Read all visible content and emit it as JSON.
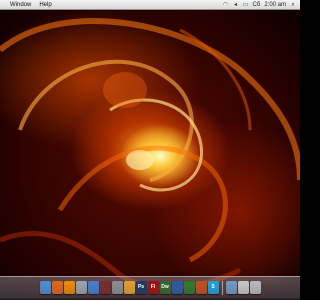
{
  "menubar": {
    "items": [
      "Window",
      "Help"
    ],
    "status_text": "Сб",
    "clock": "2:00 am",
    "status_icons": [
      "wifi-icon",
      "volume-icon",
      "battery-icon",
      "search-icon"
    ]
  },
  "dock": {
    "apps": [
      {
        "name": "finder-icon",
        "label": "",
        "color": "#4a8fd6"
      },
      {
        "name": "firefox-icon",
        "label": "",
        "color": "#e2661a"
      },
      {
        "name": "vlc-icon",
        "label": "",
        "color": "#f08a00"
      },
      {
        "name": "mail-icon",
        "label": "",
        "color": "#9aa3ad"
      },
      {
        "name": "itunes-icon",
        "label": "",
        "color": "#3f7fd2"
      },
      {
        "name": "photo-booth-icon",
        "label": "",
        "color": "#7a2a2a"
      },
      {
        "name": "system-preferences-icon",
        "label": "",
        "color": "#8b8f96"
      },
      {
        "name": "transmit-icon",
        "label": "",
        "color": "#e0a030"
      },
      {
        "name": "photoshop-icon",
        "label": "Ps",
        "color": "#1d3a63"
      },
      {
        "name": "flash-icon",
        "label": "Fl",
        "color": "#9b1010"
      },
      {
        "name": "dreamweaver-icon",
        "label": "Dw",
        "color": "#2d6b2d"
      },
      {
        "name": "word-icon",
        "label": "",
        "color": "#2a5aa8"
      },
      {
        "name": "excel-icon",
        "label": "",
        "color": "#2c7a2c"
      },
      {
        "name": "powerpoint-icon",
        "label": "",
        "color": "#c2501d"
      },
      {
        "name": "skype-icon",
        "label": "S",
        "color": "#1aa3e0"
      },
      {
        "name": "folder-icon",
        "label": "",
        "color": "#6e9bc7"
      },
      {
        "name": "stack-icon",
        "label": "",
        "color": "#c8c8c8"
      },
      {
        "name": "trash-icon",
        "label": "",
        "color": "#b8bcc2"
      }
    ]
  },
  "wallpaper": {
    "colors": [
      "#ff8c00",
      "#ffd23c",
      "#8b1200",
      "#1a0000"
    ]
  }
}
